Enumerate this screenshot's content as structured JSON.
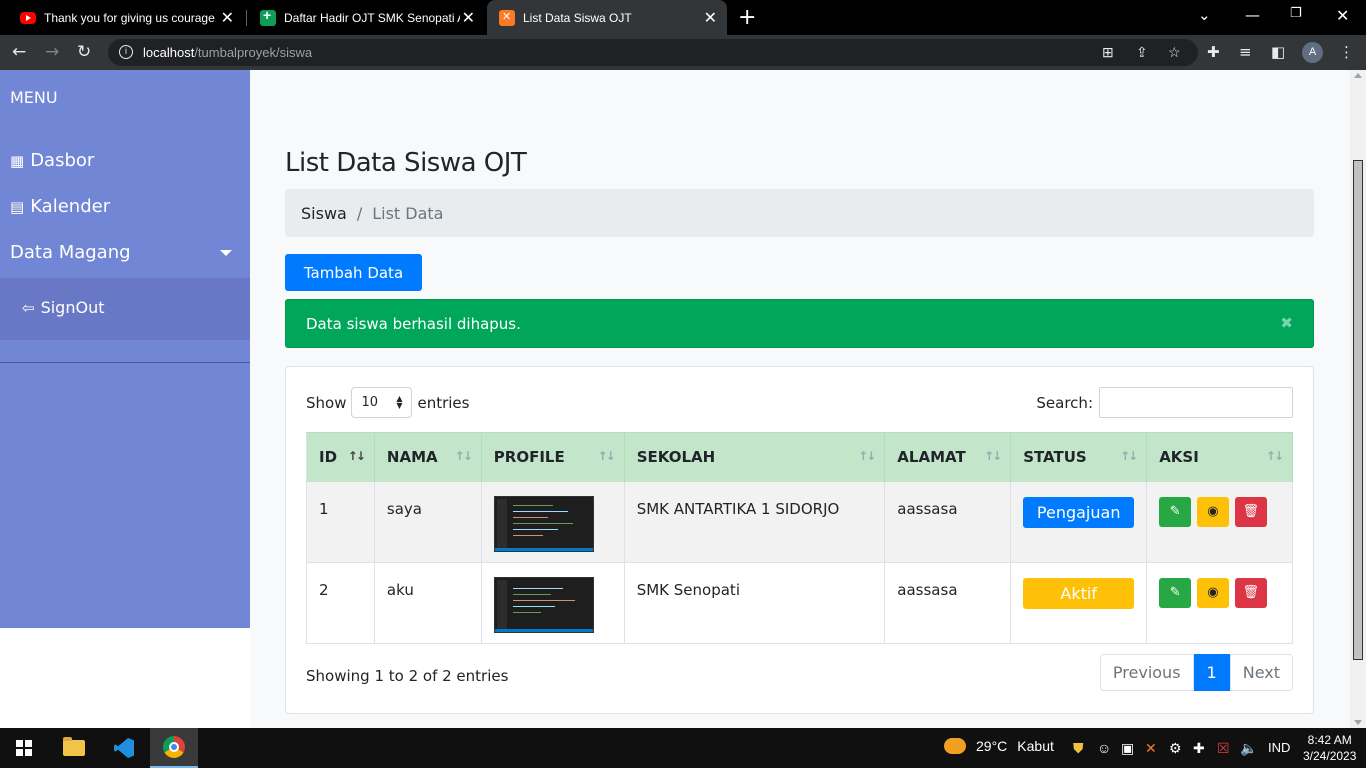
{
  "browser": {
    "tabs": [
      {
        "title": "Thank you for giving us courage,",
        "favicon": "youtube-icon"
      },
      {
        "title": "Daftar Hadir OJT SMK Senopati A",
        "favicon": "sheets-icon"
      },
      {
        "title": "List Data Siswa OJT",
        "favicon": "xampp-icon"
      }
    ],
    "url_host": "localhost",
    "url_path": "/tumbalproyek/siswa",
    "profile_initial": "A"
  },
  "sidebar": {
    "menu_title": "MENU",
    "items": [
      {
        "label": "Dasbor",
        "icon": "dashboard-icon"
      },
      {
        "label": "Kalender",
        "icon": "calendar-icon"
      },
      {
        "label": "Data Magang",
        "icon": "caret-down-icon"
      }
    ],
    "signout_label": "SignOut"
  },
  "page": {
    "title": "List Data Siswa OJT",
    "breadcrumb": [
      "Siswa",
      "List Data"
    ],
    "breadcrumb_sep": "/",
    "add_button": "Tambah Data",
    "alert": "Data siswa berhasil dihapus.",
    "alert_close": "✖"
  },
  "table": {
    "show_label": "Show",
    "entries_label": "entries",
    "length_value": "10",
    "search_label": "Search:",
    "search_value": "",
    "columns": [
      "ID",
      "NAMA",
      "PROFILE",
      "SEKOLAH",
      "ALAMAT",
      "STATUS",
      "AKSI"
    ],
    "rows": [
      {
        "id": "1",
        "nama": "saya",
        "sekolah": "SMK ANTARTIKA 1 SIDORJO",
        "alamat": "aassasa",
        "status": "Pengajuan",
        "status_color": "#007bff"
      },
      {
        "id": "2",
        "nama": "aku",
        "sekolah": "SMK Senopati",
        "alamat": "aassasa",
        "status": "Aktif",
        "status_color": "#ffc107"
      }
    ],
    "info": "Showing 1 to 2 of 2 entries",
    "pagination": {
      "previous": "Previous",
      "current": "1",
      "next": "Next"
    }
  },
  "taskbar": {
    "temperature": "29°C",
    "condition": "Kabut",
    "language": "IND",
    "time": "8:42 AM",
    "date": "3/24/2023"
  }
}
